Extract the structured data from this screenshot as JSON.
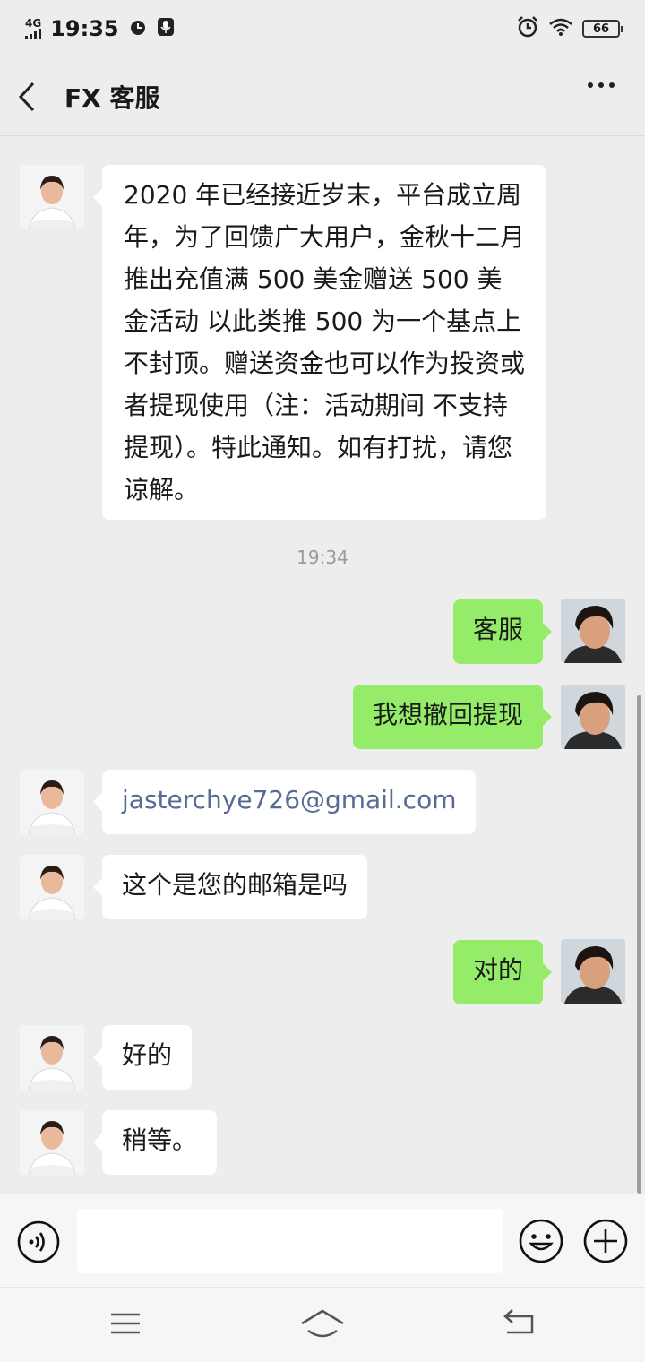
{
  "status_bar": {
    "network": "4G",
    "time": "19:35",
    "battery": "66"
  },
  "header": {
    "title": "FX 客服"
  },
  "messages": [
    {
      "side": "in",
      "text": "2020 年已经接近岁末，平台成立周年，为了回馈广大用户，金秋十二月推出充值满 500 美金赠送 500 美金活动 以此类推 500 为一个基点上不封顶。赠送资金也可以作为投资或者提现使用（注：活动期间 不支持提现）。特此通知。如有打扰，请您谅解。"
    },
    {
      "side": "time",
      "text": "19:34"
    },
    {
      "side": "out",
      "text": "客服"
    },
    {
      "side": "out",
      "text": "我想撤回提现"
    },
    {
      "side": "in",
      "text": "jasterchye726@gmail.com"
    },
    {
      "side": "in",
      "text": "这个是您的邮箱是吗"
    },
    {
      "side": "out",
      "text": "对的"
    },
    {
      "side": "in",
      "text": "好的"
    },
    {
      "side": "in",
      "text": "稍等。"
    }
  ],
  "input": {
    "value": ""
  },
  "colors": {
    "background": "#ededed",
    "outgoing_bubble": "#95ec69",
    "incoming_bubble": "#ffffff",
    "link": "#576b95"
  },
  "icons": [
    "signal-icon",
    "alarm-icon",
    "mic-icon",
    "wifi-icon",
    "battery-icon",
    "back-icon",
    "more-icon",
    "voice-icon",
    "emoji-icon",
    "plus-icon",
    "menu-icon",
    "home-icon",
    "back-nav-icon"
  ]
}
